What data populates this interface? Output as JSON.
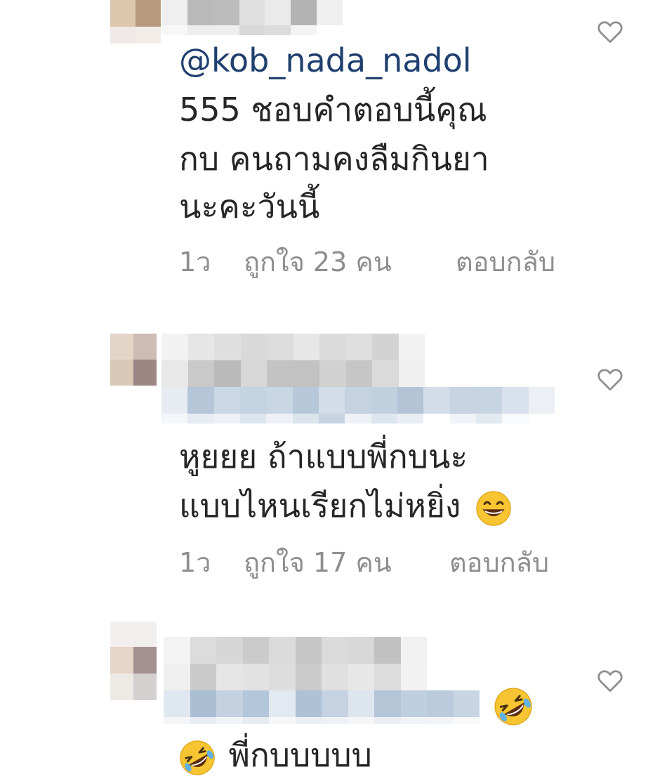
{
  "comments": [
    {
      "username_obscured": true,
      "mention": "@kob_nada_nadol",
      "lines": [
        "555 ชอบคำตอบนี้คุณ",
        "กบ คนถามคงลืมกินยา",
        "นะคะวันนี้"
      ],
      "time": "1ว",
      "likes": "ถูกใจ 23 คน",
      "reply": "ตอบกลับ",
      "like_icon": "heart-outline-icon"
    },
    {
      "username_obscured": true,
      "lines": [
        "หูยยย ถ้าแบบพี่กบนะ",
        "แบบไหนเรียกไม่หยิ่ง"
      ],
      "line_emoji": "grinning-face-icon",
      "time": "1ว",
      "likes": "ถูกใจ 17 คน",
      "reply": "ตอบกลับ",
      "like_icon": "heart-outline-icon"
    },
    {
      "username_obscured": true,
      "header_emoji": "rolling-on-floor-laughing-icon",
      "line": "พี่กบบบบบ",
      "line_emoji": "rolling-on-floor-laughing-icon",
      "like_icon": "heart-outline-icon"
    }
  ],
  "colors": {
    "text": "#262626",
    "meta": "#8e8e8e",
    "mention": "#1f3f6e",
    "emoji_yellow": "#f7c531"
  }
}
